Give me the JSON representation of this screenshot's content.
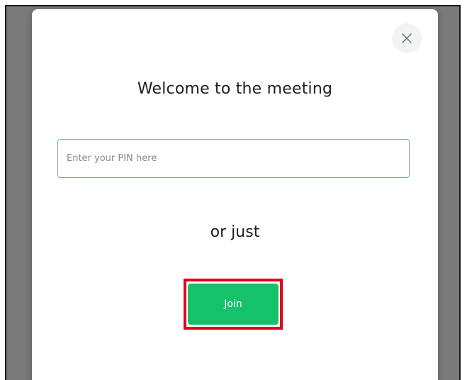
{
  "dialog": {
    "title": "Welcome to the meeting",
    "close_icon": "close-icon",
    "pin_input": {
      "placeholder": "Enter your PIN here",
      "value": ""
    },
    "divider_text": "or just",
    "join_label": "Join"
  },
  "colors": {
    "backdrop": "#7a7a7a",
    "join_button": "#15c26b",
    "input_focus_border": "#6fa3df",
    "highlight_border": "#e3001b"
  }
}
